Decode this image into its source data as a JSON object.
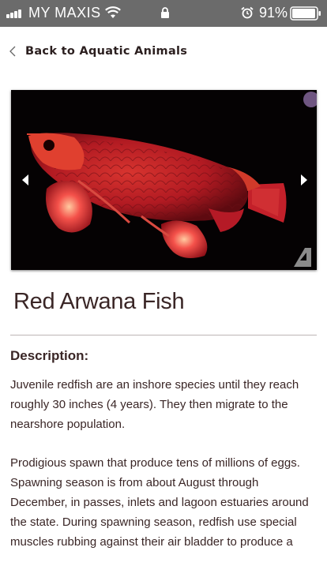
{
  "status_bar": {
    "carrier": "MY MAXIS",
    "battery_percent": "91%",
    "icons": [
      "signal-icon",
      "wifi-icon",
      "lock-icon",
      "alarm-icon",
      "battery-icon"
    ]
  },
  "nav": {
    "back_label": "Back to Aquatic Animals",
    "back_icon": "chevron-left-icon"
  },
  "gallery": {
    "prev_icon": "arrow-left-icon",
    "next_icon": "arrow-right-icon",
    "image_subject": "red arowana fish on black background"
  },
  "product": {
    "title": "Red Arwana Fish",
    "description_heading": "Description:",
    "description_paragraphs": [
      "Juvenile redfish are an inshore species until they reach roughly 30 inches (4 years). They then migrate to the nearshore population.",
      "Prodigious spawn that produce tens of millions of eggs. Spawning season is from about August through December, in passes, inlets and lagoon estuaries around the state. During spawning season, redfish use special muscles rubbing against their air bladder to produce a"
    ]
  },
  "colors": {
    "status_bar_bg": "#6b6b6b",
    "text": "#3a2626",
    "image_bg": "#050203",
    "fish_red": "#c8202a"
  }
}
